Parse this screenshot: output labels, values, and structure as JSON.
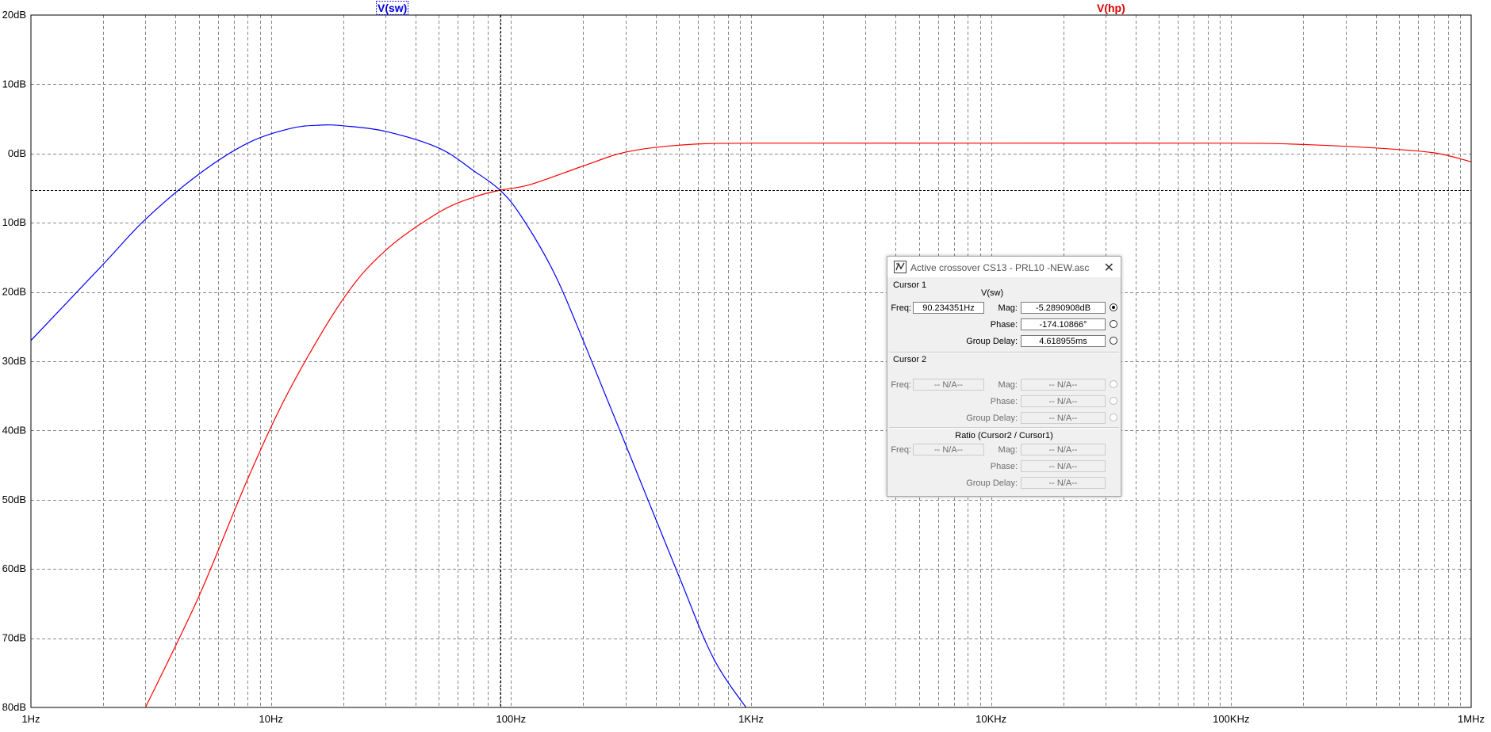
{
  "plot": {
    "trace_labels": {
      "sw": "V(sw)",
      "hp": "V(hp)"
    },
    "y_ticks": [
      "20dB",
      "10dB",
      "0dB",
      "10dB",
      "20dB",
      "30dB",
      "40dB",
      "50dB",
      "60dB",
      "70dB",
      "80dB"
    ],
    "y_values": [
      20,
      10,
      0,
      -10,
      -20,
      -30,
      -40,
      -50,
      -60,
      -70,
      -80
    ],
    "x_ticks": [
      "1Hz",
      "10Hz",
      "100Hz",
      "1KHz",
      "10KHz",
      "100KHz",
      "1MHz"
    ],
    "x_values": [
      1,
      10,
      100,
      1000,
      10000,
      100000,
      1000000
    ],
    "cursor": {
      "freq_hz": 90.234351,
      "mag_db": -5.2890908
    }
  },
  "chart_data": {
    "type": "line",
    "x_scale": "log",
    "xlim": [
      1,
      1000000
    ],
    "ylim": [
      -80,
      20
    ],
    "grid": true,
    "series": [
      {
        "name": "V(sw)",
        "color": "#0000ff",
        "points": [
          [
            1,
            -27
          ],
          [
            2,
            -16
          ],
          [
            3,
            -9.5
          ],
          [
            5,
            -3
          ],
          [
            8,
            1.5
          ],
          [
            12,
            3.6
          ],
          [
            16,
            4.1
          ],
          [
            20,
            4.0
          ],
          [
            30,
            3.2
          ],
          [
            50,
            0.8
          ],
          [
            70,
            -2.5
          ],
          [
            90,
            -5.3
          ],
          [
            110,
            -9
          ],
          [
            150,
            -17
          ],
          [
            200,
            -27
          ],
          [
            300,
            -42
          ],
          [
            500,
            -61
          ],
          [
            700,
            -73
          ],
          [
            1000,
            -81
          ]
        ]
      },
      {
        "name": "V(hp)",
        "color": "#ff0000",
        "points": [
          [
            3,
            -80
          ],
          [
            5,
            -64
          ],
          [
            8,
            -47
          ],
          [
            12,
            -34
          ],
          [
            20,
            -21
          ],
          [
            30,
            -14
          ],
          [
            50,
            -8.5
          ],
          [
            70,
            -6.3
          ],
          [
            90,
            -5.3
          ],
          [
            120,
            -4.5
          ],
          [
            200,
            -1.8
          ],
          [
            300,
            0.2
          ],
          [
            500,
            1.2
          ],
          [
            1000,
            1.5
          ],
          [
            10000,
            1.5
          ],
          [
            100000,
            1.5
          ],
          [
            200000,
            1.3
          ],
          [
            400000,
            0.8
          ],
          [
            700000,
            0.1
          ],
          [
            1000000,
            -1.2
          ]
        ]
      }
    ]
  },
  "dialog": {
    "title": "Active crossover CS13 - PRL10 -NEW.asc",
    "close": "✕",
    "cursor1": {
      "group": "Cursor 1",
      "trace": "V(sw)",
      "freq_label": "Freq:",
      "freq": "90.234351Hz",
      "mag_label": "Mag:",
      "mag": "-5.2890908dB",
      "phase_label": "Phase:",
      "phase": "-174.10866°",
      "gd_label": "Group Delay:",
      "gd": "4.618955ms"
    },
    "cursor2": {
      "group": "Cursor 2",
      "freq_label": "Freq:",
      "freq": "-- N/A--",
      "mag_label": "Mag:",
      "mag": "-- N/A--",
      "phase_label": "Phase:",
      "phase": "-- N/A--",
      "gd_label": "Group Delay:",
      "gd": "-- N/A--"
    },
    "ratio": {
      "group": "Ratio (Cursor2 / Cursor1)",
      "freq_label": "Freq:",
      "freq": "-- N/A--",
      "mag_label": "Mag:",
      "mag": "-- N/A--",
      "phase_label": "Phase:",
      "phase": "-- N/A--",
      "gd_label": "Group Delay:",
      "gd": "-- N/A--"
    }
  }
}
